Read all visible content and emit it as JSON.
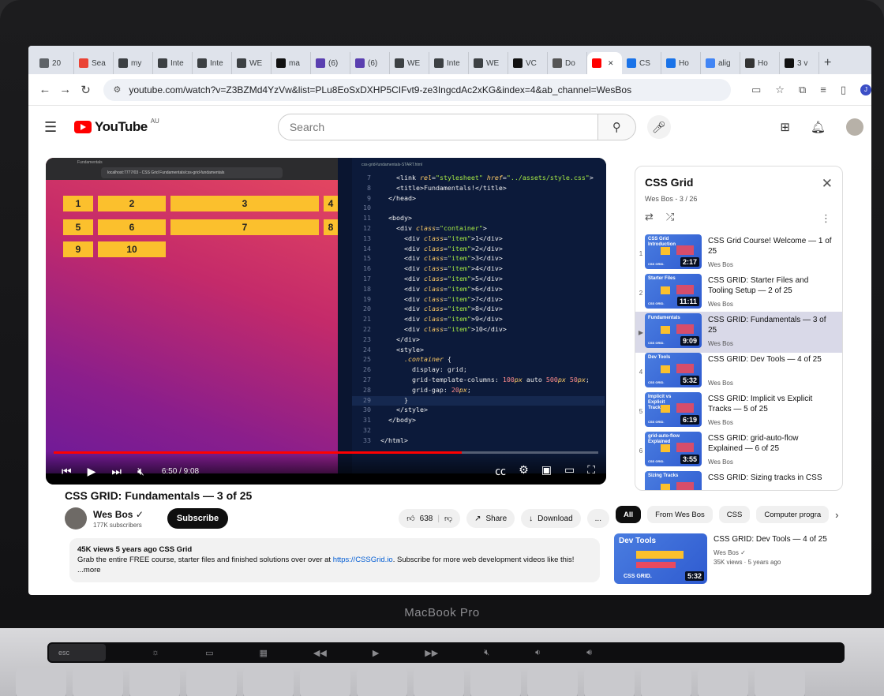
{
  "browser": {
    "tabs": [
      {
        "label": "20",
        "color": "#5f6368",
        "icon": "page-icon"
      },
      {
        "label": "Sea",
        "color": "#ea4335",
        "icon": "gmail-icon"
      },
      {
        "label": "my",
        "color": "#3c4043",
        "icon": "x-icon"
      },
      {
        "label": "Inte",
        "color": "#3c4043",
        "icon": "x-icon"
      },
      {
        "label": "Inte",
        "color": "#3c4043",
        "icon": "x-icon"
      },
      {
        "label": "WE",
        "color": "#3c4043",
        "icon": "x-icon"
      },
      {
        "label": "ma",
        "color": "#111111",
        "icon": "github-icon"
      },
      {
        "label": "(6)",
        "color": "#5a3fb0",
        "icon": "app-icon"
      },
      {
        "label": "(6)",
        "color": "#5a3fb0",
        "icon": "app-icon"
      },
      {
        "label": "WE",
        "color": "#3c4043",
        "icon": "x-icon"
      },
      {
        "label": "Inte",
        "color": "#3c4043",
        "icon": "x-icon"
      },
      {
        "label": "WE",
        "color": "#3c4043",
        "icon": "x-icon"
      },
      {
        "label": "VC",
        "color": "#111111",
        "icon": "github-icon"
      },
      {
        "label": "Do",
        "color": "#555555",
        "icon": "globe-icon"
      },
      {
        "label": "",
        "color": "#ff0000",
        "icon": "youtube-icon",
        "active": true
      },
      {
        "label": "CS",
        "color": "#1a73e8",
        "icon": "app-icon"
      },
      {
        "label": "Ho",
        "color": "#1a73e8",
        "icon": "app-icon"
      },
      {
        "label": "alig",
        "color": "#4285f4",
        "icon": "google-icon"
      },
      {
        "label": "Ho",
        "color": "#333333",
        "icon": "app-icon"
      },
      {
        "label": "3 v",
        "color": "#111111",
        "icon": "dev-icon"
      }
    ],
    "url": "youtube.com/watch?v=Z3BZMd4YzVw&list=PLu8EoSxDXHP5CIFvt9-ze3IngcdAc2xKG&index=4&ab_channel=WesBos",
    "profile_initial": "J"
  },
  "youtube": {
    "logo_text": "YouTube",
    "country": "AU",
    "search_placeholder": "Search"
  },
  "video": {
    "time": "6:50 / 9:08",
    "progress": 0.749,
    "title": "CSS GRID: Fundamentals — 3 of 25",
    "inner_browser_tab": "Fundamentals",
    "inner_browser_url": "localhost:7777/03 - CSS Grid Fundamentals/css-grid-fundamentals",
    "editor_file": "css-grid-fundamentals-START.html",
    "grid_items": [
      "1",
      "2",
      "3",
      "4",
      "5",
      "6",
      "7",
      "8",
      "9",
      "10"
    ]
  },
  "code_lines": [
    {
      "n": "7",
      "html": "    <span class='tag'>&lt;link</span> <span class='attr'>rel</span>=<span class='str'>\"stylesheet\"</span> <span class='attr'>href</span>=<span class='str'>\"../assets/style.css\"</span><span class='tag'>&gt;</span>"
    },
    {
      "n": "8",
      "html": "    <span class='tag'>&lt;title&gt;</span>Fundamentals!<span class='tag'>&lt;/title&gt;</span>"
    },
    {
      "n": "9",
      "html": "  <span class='tag'>&lt;/head&gt;</span>"
    },
    {
      "n": "10",
      "html": ""
    },
    {
      "n": "11",
      "html": "  <span class='tag'>&lt;body&gt;</span>"
    },
    {
      "n": "12",
      "html": "    <span class='tag'>&lt;div</span> <span class='attr'>class</span>=<span class='str'>\"container\"</span><span class='tag'>&gt;</span>"
    },
    {
      "n": "13",
      "html": "      <span class='tag'>&lt;div</span> <span class='attr'>class</span>=<span class='str'>\"item\"</span><span class='tag'>&gt;</span>1<span class='tag'>&lt;/div&gt;</span>"
    },
    {
      "n": "14",
      "html": "      <span class='tag'>&lt;div</span> <span class='attr'>class</span>=<span class='str'>\"item\"</span><span class='tag'>&gt;</span>2<span class='tag'>&lt;/div&gt;</span>"
    },
    {
      "n": "15",
      "html": "      <span class='tag'>&lt;div</span> <span class='attr'>class</span>=<span class='str'>\"item\"</span><span class='tag'>&gt;</span>3<span class='tag'>&lt;/div&gt;</span>"
    },
    {
      "n": "16",
      "html": "      <span class='tag'>&lt;div</span> <span class='attr'>class</span>=<span class='str'>\"item\"</span><span class='tag'>&gt;</span>4<span class='tag'>&lt;/div&gt;</span>"
    },
    {
      "n": "17",
      "html": "      <span class='tag'>&lt;div</span> <span class='attr'>class</span>=<span class='str'>\"item\"</span><span class='tag'>&gt;</span>5<span class='tag'>&lt;/div&gt;</span>"
    },
    {
      "n": "18",
      "html": "      <span class='tag'>&lt;div</span> <span class='attr'>class</span>=<span class='str'>\"item\"</span><span class='tag'>&gt;</span>6<span class='tag'>&lt;/div&gt;</span>"
    },
    {
      "n": "19",
      "html": "      <span class='tag'>&lt;div</span> <span class='attr'>class</span>=<span class='str'>\"item\"</span><span class='tag'>&gt;</span>7<span class='tag'>&lt;/div&gt;</span>"
    },
    {
      "n": "20",
      "html": "      <span class='tag'>&lt;div</span> <span class='attr'>class</span>=<span class='str'>\"item\"</span><span class='tag'>&gt;</span>8<span class='tag'>&lt;/div&gt;</span>"
    },
    {
      "n": "21",
      "html": "      <span class='tag'>&lt;div</span> <span class='attr'>class</span>=<span class='str'>\"item\"</span><span class='tag'>&gt;</span>9<span class='tag'>&lt;/div&gt;</span>"
    },
    {
      "n": "22",
      "html": "      <span class='tag'>&lt;div</span> <span class='attr'>class</span>=<span class='str'>\"item\"</span><span class='tag'>&gt;</span>10<span class='tag'>&lt;/div&gt;</span>"
    },
    {
      "n": "23",
      "html": "    <span class='tag'>&lt;/div&gt;</span>"
    },
    {
      "n": "24",
      "html": "    <span class='tag'>&lt;style&gt;</span>"
    },
    {
      "n": "25",
      "html": "      <span class='sel'>.container</span> {"
    },
    {
      "n": "26",
      "html": "        display: grid;"
    },
    {
      "n": "27",
      "html": "        grid-template-columns: <span class='num'>100</span><span class='sel'>px</span> auto <span class='num'>500</span><span class='sel'>px</span> <span class='num'>50</span><span class='sel'>px</span>;"
    },
    {
      "n": "28",
      "html": "        grid-gap: <span class='num'>20</span><span class='sel'>px</span>;"
    },
    {
      "n": "29",
      "html": "      }",
      "hl": true
    },
    {
      "n": "30",
      "html": "    <span class='tag'>&lt;/style&gt;</span>"
    },
    {
      "n": "31",
      "html": "  <span class='tag'>&lt;/body&gt;</span>"
    },
    {
      "n": "32",
      "html": ""
    },
    {
      "n": "33",
      "html": "<span class='tag'>&lt;/html&gt;</span>"
    }
  ],
  "channel": {
    "name": "Wes Bos",
    "verified": "✓",
    "subs": "177K subscribers",
    "subscribe": "Subscribe"
  },
  "actions": {
    "likes": "638",
    "share": "Share",
    "download": "Download",
    "more": "..."
  },
  "description": {
    "meta": "45K views  5 years ago  CSS Grid",
    "text": "Grab the entire FREE course, starter files and finished solutions over over at ",
    "link": "https://CSSGrid.io",
    "text2": ". Subscribe for more web development videos like this!",
    "more": "...more"
  },
  "playlist": {
    "title": "CSS Grid",
    "subtitle": "Wes Bos - 3 / 26",
    "items": [
      {
        "idx": "1",
        "thumb": "CSS Grid Introduction",
        "dur": "2:17",
        "title": "CSS Grid Course! Welcome — 1 of 25",
        "channel": "Wes Bos",
        "active": false
      },
      {
        "idx": "2",
        "thumb": "Starter Files",
        "dur": "11:11",
        "title": "CSS GRID: Starter Files and Tooling Setup — 2 of 25",
        "channel": "Wes Bos",
        "active": false
      },
      {
        "idx": "▶",
        "thumb": "Fundamentals",
        "dur": "9:09",
        "title": "CSS GRID: Fundamentals — 3 of 25",
        "channel": "Wes Bos",
        "active": true
      },
      {
        "idx": "4",
        "thumb": "Dev Tools",
        "dur": "5:32",
        "title": "CSS GRID: Dev Tools — 4 of 25",
        "channel": "Wes Bos",
        "active": false
      },
      {
        "idx": "5",
        "thumb": "Implicit vs Explicit Tracks",
        "dur": "6:19",
        "title": "CSS GRID: Implicit vs Explicit Tracks — 5 of 25",
        "channel": "Wes Bos",
        "active": false
      },
      {
        "idx": "6",
        "thumb": "grid-auto-flow Explained",
        "dur": "3:55",
        "title": "CSS GRID: grid-auto-flow Explained — 6 of 25",
        "channel": "Wes Bos",
        "active": false
      },
      {
        "idx": "",
        "thumb": "Sizing Tracks",
        "dur": "",
        "title": "CSS GRID: Sizing tracks in CSS",
        "channel": "",
        "active": false
      }
    ]
  },
  "chips": [
    "All",
    "From Wes Bos",
    "CSS",
    "Computer progra"
  ],
  "recommended": {
    "thumb_title": "Dev Tools",
    "brand": "CSS GRID.",
    "dur": "5:32",
    "title": "CSS GRID: Dev Tools — 4 of 25",
    "channel": "Wes Bos ✓",
    "meta": "35K views · 5 years ago"
  },
  "laptop": {
    "label": "MacBook Pro",
    "esc": "esc"
  }
}
